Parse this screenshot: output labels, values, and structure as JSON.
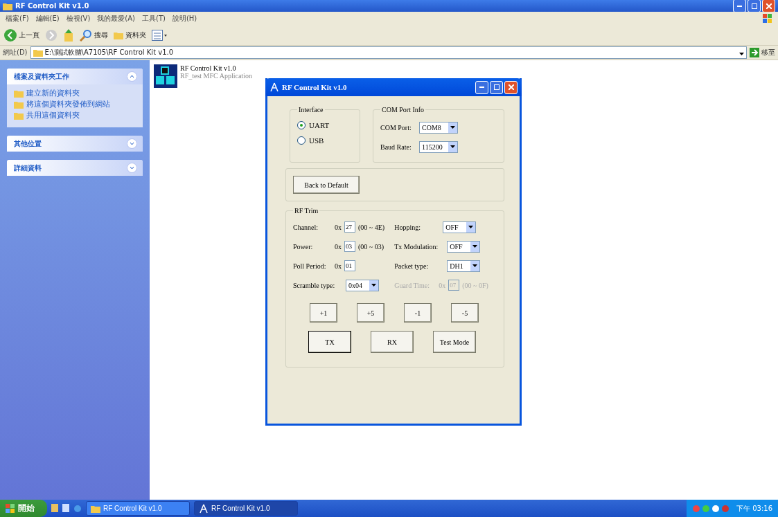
{
  "explorer": {
    "title": "RF Control Kit v1.0",
    "menu": [
      "檔案(F)",
      "編輯(E)",
      "檢視(V)",
      "我的最愛(A)",
      "工具(T)",
      "說明(H)"
    ],
    "toolbar": {
      "back": "上一頁",
      "search": "搜尋",
      "folders": "資料夾"
    },
    "address": {
      "label": "網址(D)",
      "value": "E:\\測試軟體\\A7105\\RF Control Kit v1.0",
      "go": "移至"
    },
    "sidebar": [
      {
        "title": "檔案及資料夾工作",
        "expanded": true,
        "items": [
          "建立新的資料夾",
          "將這個資料夾發佈到網站",
          "共用這個資料夾"
        ]
      },
      {
        "title": "其他位置",
        "expanded": false
      },
      {
        "title": "詳細資料",
        "expanded": false
      }
    ],
    "files": [
      {
        "name": "RF Control Kit v1.0",
        "description": "RF_test MFC Application"
      }
    ]
  },
  "dialog": {
    "title": "RF Control Kit v1.0",
    "interface": {
      "title": "Interface",
      "options": [
        {
          "label": "UART",
          "selected": true
        },
        {
          "label": "USB",
          "selected": false
        }
      ]
    },
    "com_port_info": {
      "title": "COM Port Info",
      "fields": [
        {
          "label": "COM Port:",
          "value": "COM8"
        },
        {
          "label": "Baud Rate:",
          "value": "115200"
        }
      ]
    },
    "back_to_default": "Back to Default",
    "rf_trim": {
      "title": "RF Trim",
      "left": [
        {
          "kind": "hex",
          "label": "Channel:",
          "prefix": "0x",
          "value": "27",
          "range": "(00 ~ 4E)"
        },
        {
          "kind": "hex",
          "label": "Power:",
          "prefix": "0x",
          "value": "03",
          "range": "(00 ~ 03)"
        },
        {
          "kind": "hex",
          "label": "Poll Period:",
          "prefix": "0x",
          "value": "01"
        },
        {
          "kind": "select",
          "label": "Scramble type:",
          "value": "0x04"
        }
      ],
      "right": [
        {
          "kind": "select",
          "label": "Hopping:",
          "value": "OFF",
          "disabled": false
        },
        {
          "kind": "select",
          "label": "Tx Modulation:",
          "value": "OFF",
          "disabled": false
        },
        {
          "kind": "select",
          "label": "Packet type:",
          "value": "DH1",
          "disabled": false
        },
        {
          "kind": "hex",
          "label": "Guard Time:",
          "prefix": "0x",
          "value": "07",
          "range": "(00 ~ 0F)",
          "disabled": true
        }
      ],
      "steps": [
        "+1",
        "+5",
        "-1",
        "-5"
      ],
      "actions": [
        {
          "label": "TX",
          "selected": true
        },
        {
          "label": "RX",
          "selected": false
        },
        {
          "label": "Test Mode",
          "selected": false
        }
      ]
    }
  },
  "taskbar": {
    "start": "開始",
    "tasks": [
      {
        "label": "RF Control Kit v1.0",
        "selected": false
      },
      {
        "label": "RF Control Kit v1.0",
        "selected": true
      }
    ],
    "clock": "下午 03:16"
  }
}
